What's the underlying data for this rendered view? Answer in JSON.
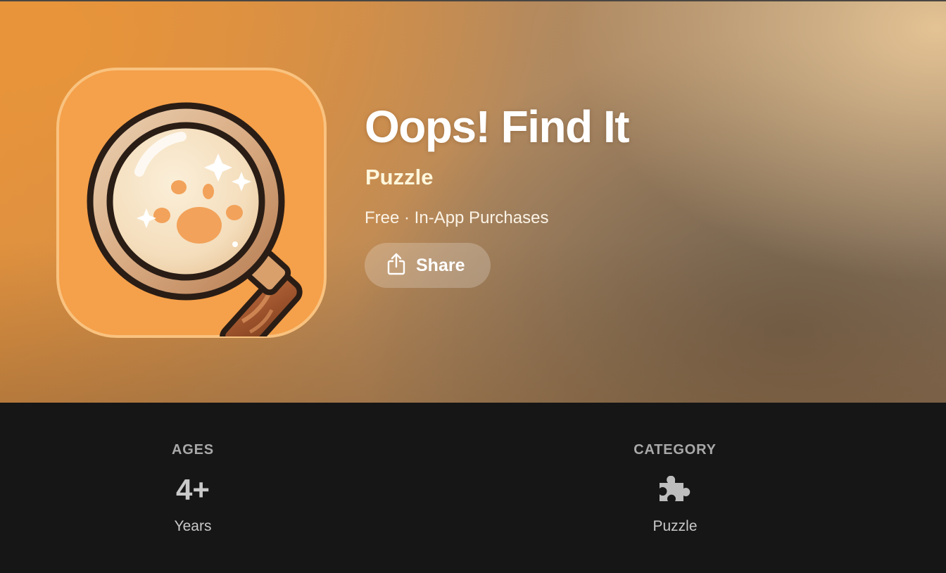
{
  "app": {
    "title": "Oops! Find It",
    "category_link": "Puzzle",
    "price_line": "Free · In-App Purchases",
    "icon_name": "magnifying-glass-paw-app-icon"
  },
  "actions": {
    "share_label": "Share",
    "share_icon": "share-icon"
  },
  "info": {
    "ages": {
      "heading": "AGES",
      "value": "4+",
      "caption": "Years"
    },
    "category": {
      "heading": "CATEGORY",
      "icon": "puzzle-piece-icon",
      "caption": "Puzzle"
    }
  },
  "colors": {
    "hero_orange": "#e3923d",
    "hero_cream": "#e8c696",
    "hero_taupe": "#8c7866",
    "info_background": "#161616",
    "icon_background": "#f5a04a",
    "category_link_color": "#fff7dc",
    "muted_text": "#a9a9a9"
  }
}
